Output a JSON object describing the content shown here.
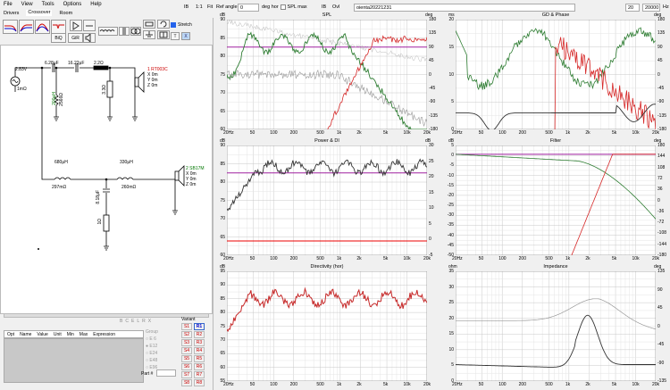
{
  "menu": [
    "File",
    "View",
    "Tools",
    "Options",
    "Help"
  ],
  "tabs": [
    "Drivers",
    "Crossover",
    "Room"
  ],
  "top": {
    "b1": "IB",
    "b2": "1:1",
    "b3": "Fit",
    "ref_label": "Ref angle",
    "ref_value": "0",
    "deg_label": "deg hor",
    "spl_max": "SPL max",
    "b4": "Ovl",
    "file": "oienta20221231",
    "f1": "20",
    "f2": "20000",
    "hz": "Hz"
  },
  "toolbar": {
    "biq": "BiQ",
    "gr": "GiR",
    "stretch": "Stretch"
  },
  "schem": {
    "src_v": "2.83V",
    "src_r": "1mΩ",
    "c1": "6.28μF",
    "c2": "16.22μF",
    "l1": "2.2Ω",
    "l2": "200μH",
    "l2r": "2566Ω",
    "r1": "3.3Ω",
    "drv1": "1 RT003C",
    "drv1b": "X 0m",
    "drv1c": "Y 0m",
    "drv1d": "Z 0m",
    "l3": "680μH",
    "l3r": "297mΩ",
    "l4": "330μH",
    "l4r": "260mΩ",
    "c3": "8.18μF",
    "r2": "1Ω",
    "drv2": "2 SB17M",
    "drv2b": "X 0m",
    "drv2c": "Y 0m",
    "drv2d": "Z 0m"
  },
  "table": {
    "cols": [
      "Opt",
      "Name",
      "Value",
      "Unit",
      "Min",
      "Max",
      "Expression"
    ]
  },
  "smallbtns": [
    "B",
    "C",
    "E",
    "L",
    "R",
    "X"
  ],
  "group": {
    "title": "Group",
    "items": [
      "E 6",
      "E12",
      "E24",
      "E48",
      "E96"
    ]
  },
  "part_label": "Part #",
  "variant": {
    "title": "Variant",
    "rows": [
      [
        "S1",
        "R1"
      ],
      [
        "S2",
        "R2"
      ],
      [
        "S3",
        "R3"
      ],
      [
        "S4",
        "R4"
      ],
      [
        "S5",
        "R5"
      ],
      [
        "S6",
        "R6"
      ],
      [
        "S7",
        "R7"
      ],
      [
        "S8",
        "R8"
      ]
    ]
  },
  "xticks": [
    "20Hz",
    "50",
    "100",
    "200",
    "500",
    "1k",
    "2k",
    "5k",
    "10k",
    "20k"
  ],
  "panels": {
    "spl": {
      "title": "SPL",
      "yl": "dB",
      "yr": "deg",
      "left": [
        "90",
        "85",
        "80",
        "75",
        "70",
        "65",
        "60"
      ],
      "right": [
        "180",
        "135",
        "90",
        "45",
        "0",
        "-45",
        "-90",
        "-135",
        "-180"
      ]
    },
    "gd": {
      "title": "GD & Phase",
      "yl": "ms",
      "yr": "deg",
      "left": [
        "20",
        "15",
        "10",
        "5",
        "0"
      ],
      "right": [
        "180",
        "135",
        "90",
        "45",
        "0",
        "-45",
        "-90",
        "-135",
        "-180"
      ]
    },
    "power": {
      "title": "Power & DI",
      "yl": "dB",
      "yr": "dB",
      "left": [
        "90",
        "85",
        "80",
        "75",
        "70",
        "65",
        "60"
      ],
      "right": [
        "30",
        "25",
        "20",
        "15",
        "10",
        "5",
        "0",
        "-5"
      ]
    },
    "filter": {
      "title": "Filter",
      "yl": "dB",
      "yr": "deg",
      "left": [
        "5",
        "0",
        "-5",
        "-10",
        "-15",
        "-20",
        "-25",
        "-30",
        "-35",
        "-40",
        "-45",
        "-50"
      ],
      "right": [
        "180",
        "144",
        "108",
        "72",
        "36",
        "0",
        "-36",
        "-72",
        "-108",
        "-144",
        "-180"
      ]
    },
    "dir": {
      "title": "Directivity (hor)",
      "yl": "dB",
      "left": [
        "95",
        "90",
        "85",
        "80",
        "75",
        "70",
        "65",
        "60",
        "55"
      ]
    },
    "imp": {
      "title": "Impedance",
      "yl": "ohm",
      "yr": "deg",
      "left": [
        "35",
        "30",
        "25",
        "20",
        "15",
        "10",
        "5",
        "0"
      ],
      "right": [
        "135",
        "90",
        "45",
        "0",
        "-45",
        "-90",
        "-135"
      ]
    }
  }
}
